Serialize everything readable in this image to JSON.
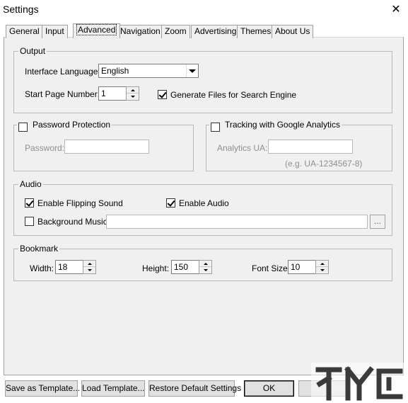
{
  "window": {
    "title": "Settings"
  },
  "tabs": [
    {
      "label": "General"
    },
    {
      "label": "Input"
    },
    {
      "label": "Advanced",
      "active": true
    },
    {
      "label": "Navigation"
    },
    {
      "label": "Zoom"
    },
    {
      "label": "Advertising"
    },
    {
      "label": "Themes"
    },
    {
      "label": "About Us"
    }
  ],
  "output": {
    "legend": "Output",
    "interface_language_label": "Interface Language:",
    "interface_language_value": "English",
    "start_page_label": "Start Page Number:",
    "start_page_value": "1",
    "generate_files_label": "Generate Files for Search Engine",
    "generate_files_checked": true
  },
  "password": {
    "legend": "Password Protection",
    "checked": false,
    "field_label": "Password:",
    "field_value": ""
  },
  "tracking": {
    "legend": "Tracking with Google Analytics",
    "checked": false,
    "field_label": "Analytics UA:",
    "field_value": "",
    "hint": "(e.g. UA-1234567-8)"
  },
  "audio": {
    "legend": "Audio",
    "flipping_label": "Enable Flipping Sound",
    "flipping_checked": true,
    "enable_audio_label": "Enable Audio",
    "enable_audio_checked": true,
    "background_label": "Background Music:",
    "background_checked": false,
    "background_value": "",
    "browse_label": "..."
  },
  "bookmark": {
    "legend": "Bookmark",
    "width_label": "Width:",
    "width_value": "18",
    "height_label": "Height:",
    "height_value": "150",
    "font_size_label": "Font Size:",
    "font_size_value": "10"
  },
  "buttons": {
    "save_template": "Save as Template...",
    "load_template": "Load Template...",
    "restore_defaults": "Restore Default Settings",
    "ok": "OK"
  },
  "colors": {
    "panel_bg": "#f0f0f0",
    "button_bg": "#e1e1e1",
    "disabled_text": "#8f8f8f"
  }
}
